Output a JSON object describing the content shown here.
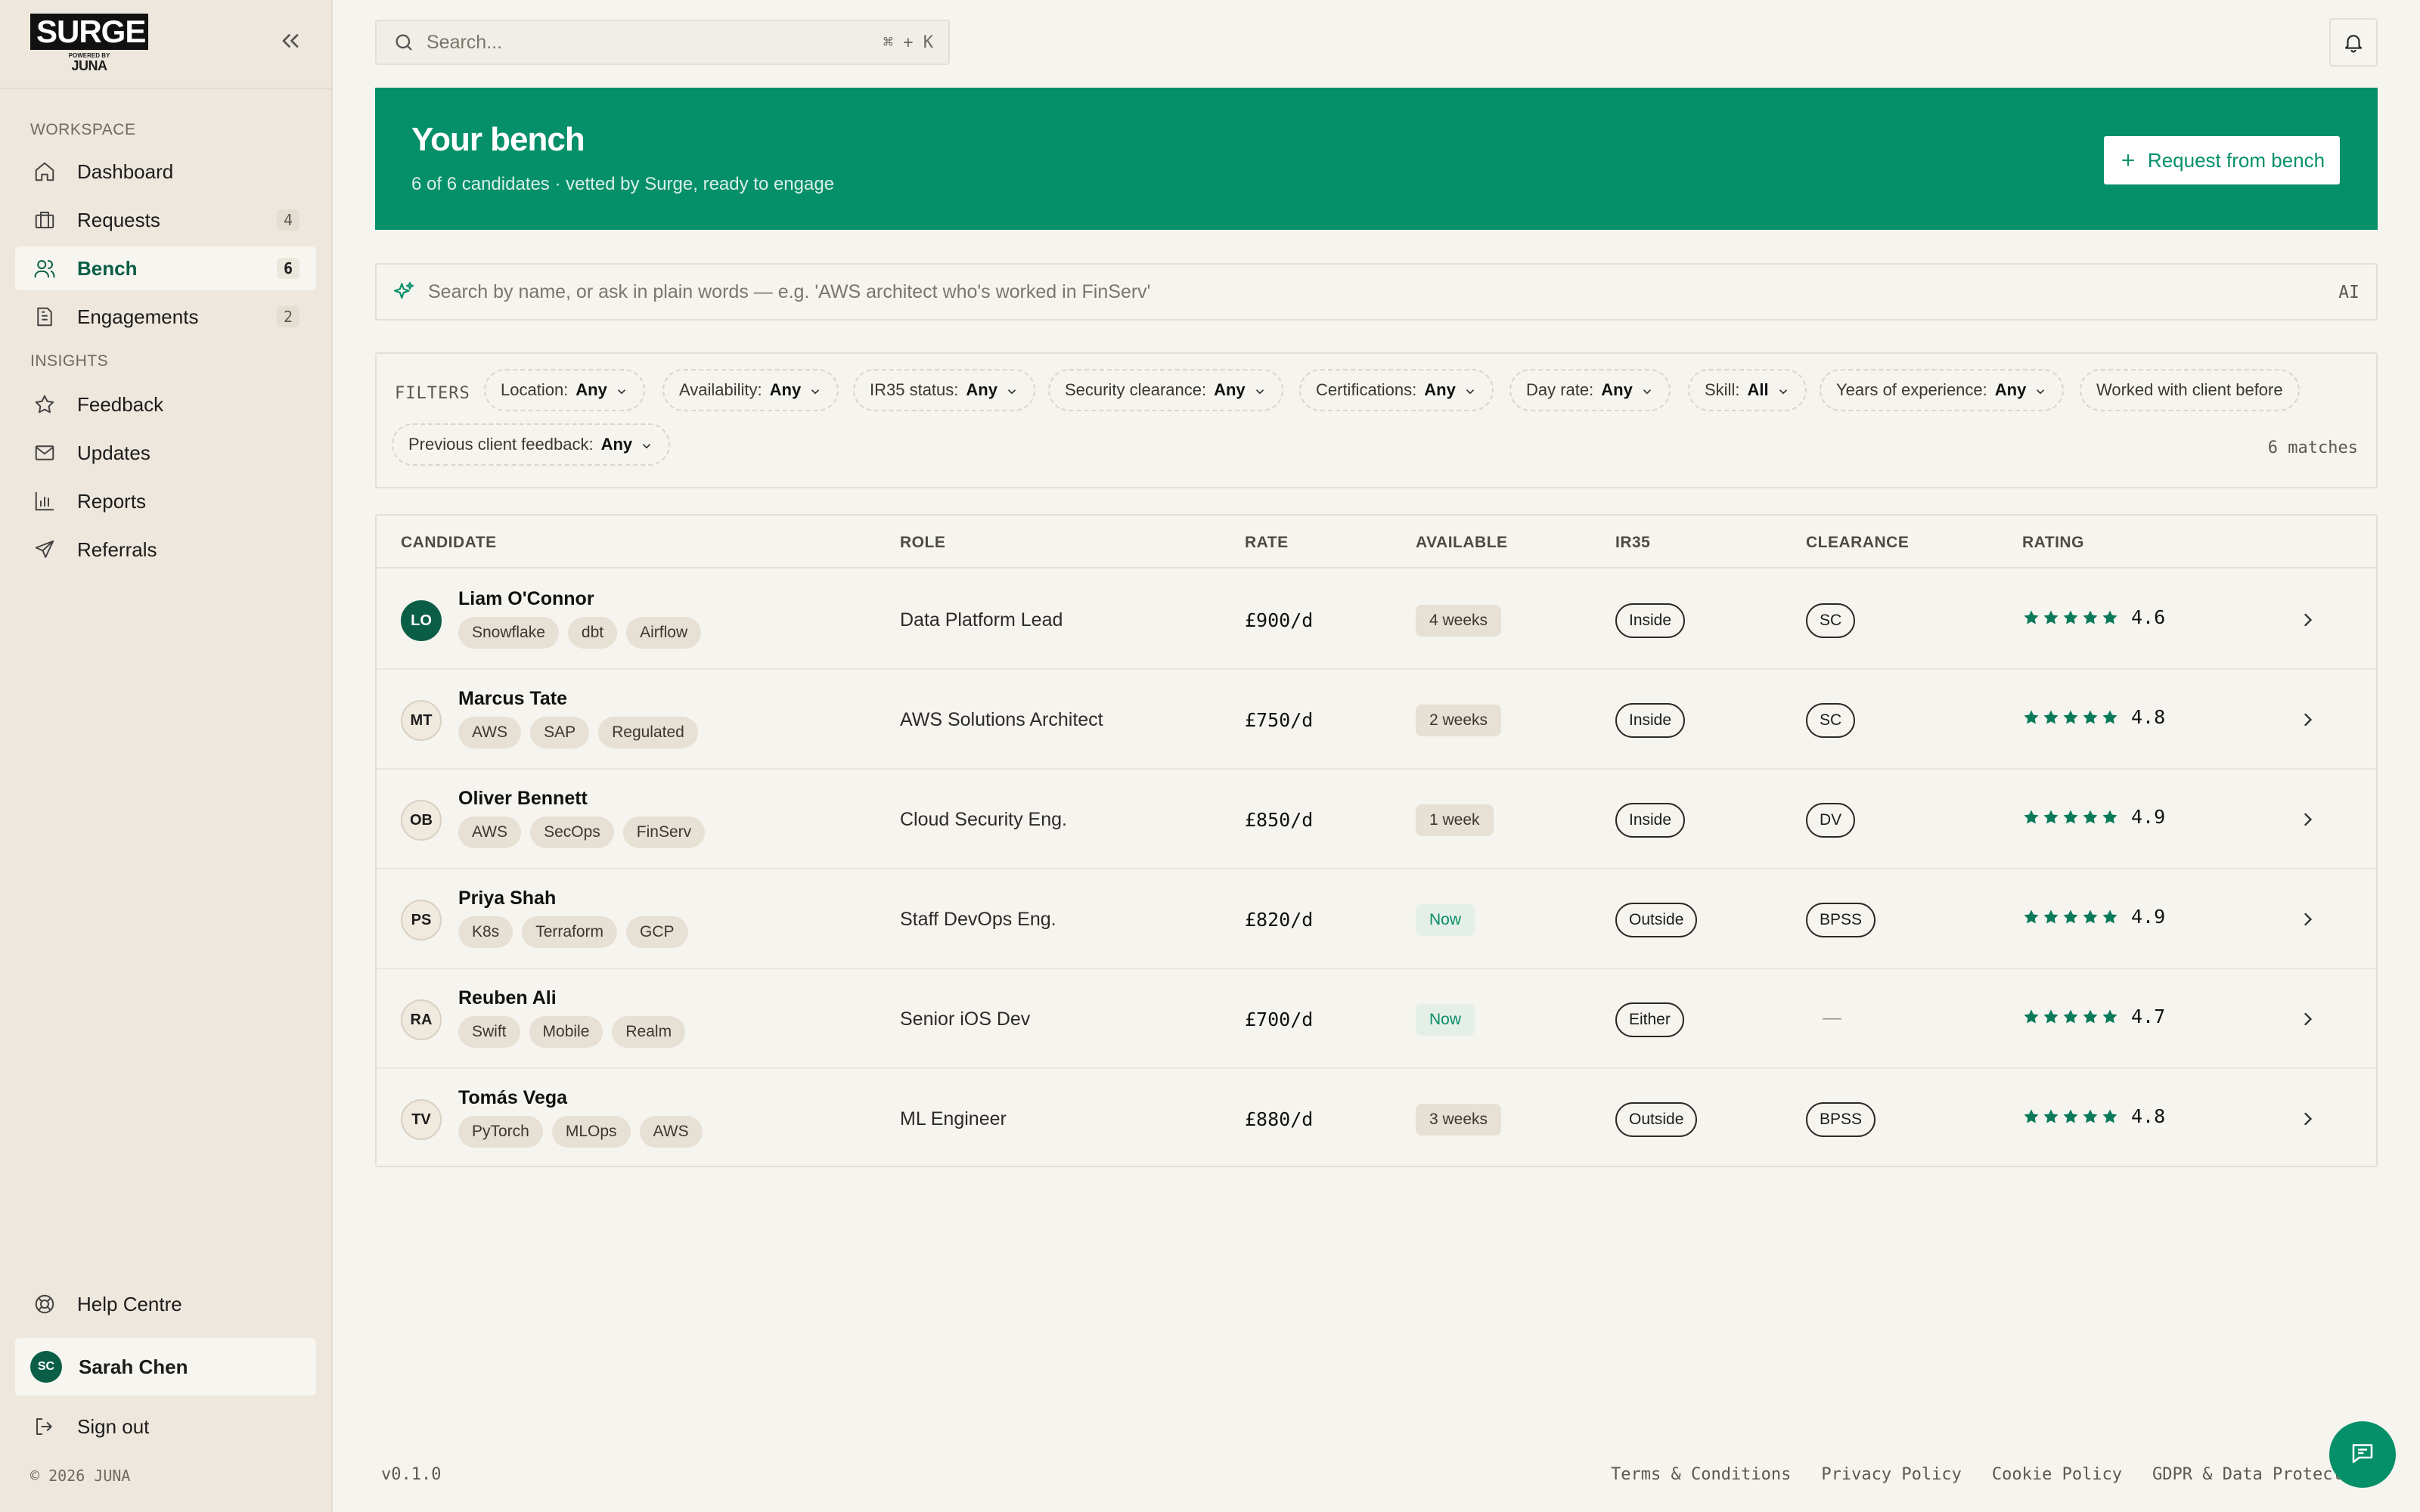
{
  "brand": {
    "name": "SURGE",
    "powered_by": "POWERED BY",
    "sub": "JUNA"
  },
  "search": {
    "placeholder": "Search...",
    "shortcut": "⌘ + K"
  },
  "sidebar": {
    "workspace_label": "WORKSPACE",
    "insights_label": "INSIGHTS",
    "workspace_items": [
      {
        "label": "Dashboard",
        "icon": "home-icon"
      },
      {
        "label": "Requests",
        "icon": "briefcase-icon",
        "count": "4"
      },
      {
        "label": "Bench",
        "icon": "users-icon",
        "count": "6",
        "active": true
      },
      {
        "label": "Engagements",
        "icon": "document-icon",
        "count": "2"
      }
    ],
    "insights_items": [
      {
        "label": "Feedback",
        "icon": "star-icon"
      },
      {
        "label": "Updates",
        "icon": "mail-icon"
      },
      {
        "label": "Reports",
        "icon": "bar-chart-icon"
      },
      {
        "label": "Referrals",
        "icon": "send-icon"
      }
    ],
    "help": "Help Centre",
    "user": {
      "initials": "SC",
      "name": "Sarah Chen"
    },
    "sign_out": "Sign out",
    "copyright": "© 2026 JUNA"
  },
  "hero": {
    "title": "Your bench",
    "subtitle": "6 of 6 candidates · vetted by Surge, ready to engage",
    "button": "Request from bench"
  },
  "ai_search": {
    "placeholder": "Search by name, or ask in plain words — e.g. 'AWS architect who's worked in FinServ'",
    "tag": "AI"
  },
  "filters": {
    "label": "FILTERS",
    "chips": [
      {
        "label": "Location:",
        "value": "Any"
      },
      {
        "label": "Availability:",
        "value": "Any"
      },
      {
        "label": "IR35 status:",
        "value": "Any"
      },
      {
        "label": "Security clearance:",
        "value": "Any"
      },
      {
        "label": "Certifications:",
        "value": "Any"
      },
      {
        "label": "Day rate:",
        "value": "Any"
      },
      {
        "label": "Skill:",
        "value": "All"
      },
      {
        "label": "Years of experience:",
        "value": "Any"
      },
      {
        "label": "Worked with client before",
        "value": ""
      },
      {
        "label": "Previous client feedback:",
        "value": "Any"
      }
    ],
    "matches": "6 matches"
  },
  "table": {
    "headers": [
      "CANDIDATE",
      "ROLE",
      "RATE",
      "AVAILABLE",
      "IR35",
      "CLEARANCE",
      "RATING"
    ],
    "rows": [
      {
        "initials": "LO",
        "name": "Liam O'Connor",
        "tags": [
          "Snowflake",
          "dbt",
          "Airflow"
        ],
        "role": "Data Platform Lead",
        "rate": "£900/d",
        "available": "4 weeks",
        "ir35": "Inside",
        "clearance": "SC",
        "rating": "4.6",
        "stars": 5
      },
      {
        "initials": "MT",
        "name": "Marcus Tate",
        "tags": [
          "AWS",
          "SAP",
          "Regulated"
        ],
        "role": "AWS Solutions Architect",
        "rate": "£750/d",
        "available": "2 weeks",
        "ir35": "Inside",
        "clearance": "SC",
        "rating": "4.8",
        "stars": 5
      },
      {
        "initials": "OB",
        "name": "Oliver Bennett",
        "tags": [
          "AWS",
          "SecOps",
          "FinServ"
        ],
        "role": "Cloud Security Eng.",
        "rate": "£850/d",
        "available": "1 week",
        "ir35": "Inside",
        "clearance": "DV",
        "rating": "4.9",
        "stars": 5
      },
      {
        "initials": "PS",
        "name": "Priya Shah",
        "tags": [
          "K8s",
          "Terraform",
          "GCP"
        ],
        "role": "Staff DevOps Eng.",
        "rate": "£820/d",
        "available": "Now",
        "ir35": "Outside",
        "clearance": "BPSS",
        "rating": "4.9",
        "stars": 5
      },
      {
        "initials": "RA",
        "name": "Reuben Ali",
        "tags": [
          "Swift",
          "Mobile",
          "Realm"
        ],
        "role": "Senior iOS Dev",
        "rate": "£700/d",
        "available": "Now",
        "ir35": "Either",
        "clearance": "—",
        "rating": "4.7",
        "stars": 5
      },
      {
        "initials": "TV",
        "name": "Tomás Vega",
        "tags": [
          "PyTorch",
          "MLOps",
          "AWS"
        ],
        "role": "ML Engineer",
        "rate": "£880/d",
        "available": "3 weeks",
        "ir35": "Outside",
        "clearance": "BPSS",
        "rating": "4.8",
        "stars": 5
      }
    ]
  },
  "footer": {
    "version": "v0.1.0",
    "links": [
      "Terms & Conditions",
      "Privacy Policy",
      "Cookie Policy",
      "GDPR & Data Protection"
    ]
  },
  "colors": {
    "accent": "#06906a",
    "accent_dark": "#0b5e46",
    "sidebar_bg": "#ede7dd",
    "page_bg": "#f6f4ef"
  }
}
